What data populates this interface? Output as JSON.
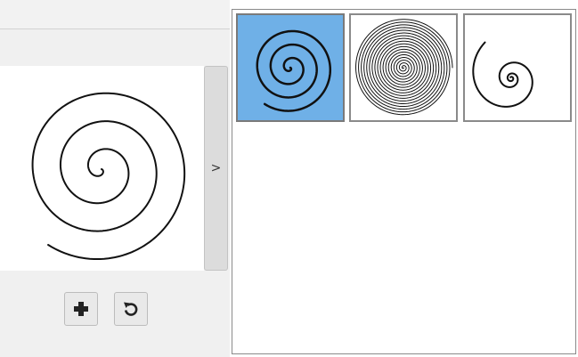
{
  "preview": {
    "spiral": {
      "type": "archimedean",
      "turns": 3.3
    },
    "expand_button_label": ">"
  },
  "toolbar": {
    "add_icon": "plus-icon",
    "reset_icon": "rotate-icon"
  },
  "gallery": {
    "selected_index": 0,
    "selected_color": "#6fb0e7",
    "items": [
      {
        "name": "archimedean-spiral",
        "turns": 3.3
      },
      {
        "name": "dense-spiral",
        "turns": 18
      },
      {
        "name": "logarithmic-spiral",
        "turns": 3
      }
    ]
  }
}
